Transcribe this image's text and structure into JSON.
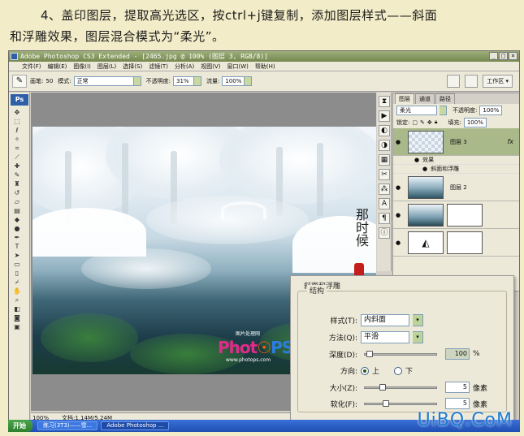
{
  "caption": {
    "line1": "4、盖印图层，提取高光选区，按ctrl+j键复制，添加图层样式——斜面",
    "line2": "和浮雕效果，图层混合模式为“柔光”。"
  },
  "titlebar": {
    "title": "Adobe Photoshop CS3 Extended - [2465.jpg @ 100% (图层 3, RGB/8)]"
  },
  "menu": [
    "文件(F)",
    "编辑(E)",
    "图像(I)",
    "图层(L)",
    "选择(S)",
    "滤镜(T)",
    "分析(A)",
    "视图(V)",
    "窗口(W)",
    "帮助(H)"
  ],
  "options": {
    "brush_label": "画笔:",
    "brush_size": "50",
    "mode_label": "模式:",
    "mode_value": "正常",
    "opacity_label": "不透明度:",
    "opacity_value": "31%",
    "flow_label": "流量:",
    "flow_value": "100%",
    "workspace": "工作区 ▾"
  },
  "toolbox": {
    "logo": "Ps"
  },
  "photo": {
    "calligraphy": "那时候",
    "logo_top": "图片处理网",
    "logo_a": "Phot",
    "logo_b": "☉",
    "logo_c": "PS",
    "logo_url": "www.photops.com"
  },
  "status": {
    "zoom": "100%",
    "doc": "文档:1.14M/5.24M"
  },
  "layers_panel": {
    "tabs": [
      "图层",
      "通道",
      "路径"
    ],
    "blend_mode": "柔光",
    "opacity_label": "不透明度:",
    "opacity_value": "100%",
    "lock_label": "锁定:",
    "fill_label": "填充:",
    "fill_value": "100%",
    "layer3": "图层 3",
    "effects": "效果",
    "bevel": "斜面和浮雕",
    "layer2": "图层 2"
  },
  "dialog": {
    "title": "斜面和浮雕",
    "group": "结构",
    "style_label": "样式(T):",
    "style_value": "内斜面",
    "technique_label": "方法(Q):",
    "technique_value": "平滑",
    "depth_label": "深度(D):",
    "depth_value": "100",
    "depth_unit": "%",
    "direction_label": "方向:",
    "dir_up": "上",
    "dir_down": "下",
    "size_label": "大小(Z):",
    "size_value": "5",
    "size_unit": "像素",
    "soften_label": "软化(F):",
    "soften_value": "5",
    "soften_unit": "像素"
  },
  "taskbar": {
    "start": "开始",
    "items": [
      "练习(3T3)——雪...",
      "Adobe Photoshop ..."
    ]
  },
  "watermark": "UiBQ.CoM"
}
